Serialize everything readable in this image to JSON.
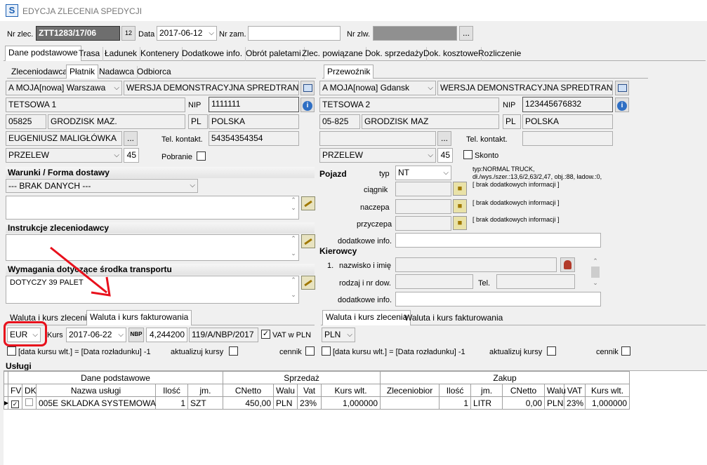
{
  "window": {
    "title": "EDYCJA ZLECENIA SPEDYCJI",
    "app_icon": "S"
  },
  "header": {
    "nr_zlec_label": "Nr zlec.",
    "nr_zlec_value": "ZTT1283/17/06",
    "data_label": "Data",
    "data_value": "2017-06-12",
    "nr_zam_label": "Nr zam.",
    "nr_zam_value": "",
    "nr_zlw_label": "Nr zlw.",
    "nr_zlw_value": "",
    "ellipsis": "..."
  },
  "main_tabs": [
    "Dane podstawowe",
    "Trasa",
    "Ładunek",
    "Kontenery",
    "Dodatkowe info.",
    "Obrót paletami",
    "Zlec. powiązane",
    "Dok. sprzedaży",
    "Dok. kosztowe",
    "Rozliczenie"
  ],
  "left": {
    "tabs": [
      "Zleceniodawca",
      "Płatnik",
      "Nadawca",
      "Odbiorca"
    ],
    "short_name": "A MOJA[nowa] Warszawa",
    "full_name": "WERSJA DEMONSTRACYJNA SPREDTRANS SQL",
    "street": "TETSOWA 1",
    "nip_label": "NIP",
    "nip_value": "1111111",
    "postal": "05825",
    "city": "GRODZISK MAZ.",
    "country_code": "PL",
    "country": "POLSKA",
    "contact": "EUGENIUSZ  MALIGŁÓWKA",
    "tel_label": "Tel. kontakt.",
    "tel_value": "54354354354",
    "payment": "PRZELEW",
    "days": "45",
    "pobranie_label": "Pobranie"
  },
  "right": {
    "tabs": [
      "Przewoźnik"
    ],
    "short_name": "A MOJA[nowa] Gdansk",
    "full_name": "WERSJA DEMONSTRACYJNA SPREDTRANS SQL WE",
    "street": "TETSOWA 2",
    "nip_label": "NIP",
    "nip_value": "123445676832",
    "postal": "05-825",
    "city": "GRODZISK MAZ",
    "country_code": "PL",
    "country": "POLSKA",
    "contact": "",
    "tel_label": "Tel. kontakt.",
    "tel_value": "",
    "payment": "PRZELEW",
    "days": "45",
    "skonto_label": "Skonto"
  },
  "warunki": {
    "title": "Warunki / Forma dostawy",
    "select_value": "--- BRAK DANYCH ---",
    "memo": ""
  },
  "instrukcje": {
    "title": "Instrukcje zleceniodawcy",
    "memo": ""
  },
  "wymagania": {
    "title": "Wymagania dotyczące środka transportu",
    "memo": "DOTYCZY 39 PALET"
  },
  "pojazd": {
    "title": "Pojazd",
    "typ_label": "typ",
    "typ_value": "NT",
    "typ_info1": "typ:NORMAL TRUCK,",
    "typ_info2": "dł./wys./szer.:13,6/2,63/2,47, obj.:88, ładow.:0,",
    "typ_info3": "[ brak dodatkowych informacji ]",
    "ciagnik_label": "ciągnik",
    "naczepa_label": "naczepa",
    "naczepa_info": "[ brak dodatkowych informacji ]",
    "przyczepa_label": "przyczepa",
    "przyczepa_info": "[ brak dodatkowych informacji ]",
    "dodatkowe_label": "dodatkowe info."
  },
  "kierowcy": {
    "title": "Kierowcy",
    "nr": "1.",
    "name_label": "nazwisko i imię",
    "doc_label": "rodzaj i nr dow.",
    "tel_label": "Tel.",
    "dodatkowe_label": "dodatkowe info."
  },
  "waluta_left": {
    "tabs": [
      "Waluta i kurs zlecenia",
      "Waluta i kurs fakturowania"
    ],
    "currency": "EUR",
    "kurs_label": "Kurs",
    "kurs_date": "2017-06-22",
    "nbp": "NBP",
    "rate": "4,244200",
    "table_no": "119/A/NBP/2017",
    "vat_label": "VAT w PLN",
    "data_kursu_label": "[data kursu wlt.] = [Data rozładunku] -1",
    "aktualizuj_label": "aktualizuj kursy",
    "cennik_label": "cennik"
  },
  "waluta_right": {
    "tabs": [
      "Waluta i kurs zlecenia",
      "Waluta i kurs fakturowania"
    ],
    "currency": "PLN",
    "data_kursu_label": "[data kursu wlt.] = [Data rozładunku] -1",
    "aktualizuj_label": "aktualizuj kursy",
    "cennik_label": "cennik"
  },
  "uslugi": {
    "title": "Usługi",
    "group_headers": [
      "Dane podstawowe",
      "Sprzedaż",
      "Zakup"
    ],
    "columns": [
      "FV",
      "DK",
      "Nazwa usługi",
      "Ilość",
      "jm.",
      "CNetto",
      "Walu",
      "Vat",
      "Kurs wlt.",
      "Zleceniobior",
      "Ilość",
      "jm.",
      "CNetto",
      "Walu",
      "VAT",
      "Kurs wlt."
    ],
    "rows": [
      [
        "",
        "",
        "005E SKLADKA SYSTEMOWA",
        "1",
        "SZT",
        "450,00",
        "PLN",
        "23%",
        "1,000000",
        "",
        "1",
        "LITR",
        "0,00",
        "PLN",
        "23%",
        "1,000000"
      ]
    ]
  },
  "colors": {
    "highlight": "#e8101c",
    "arrow": "#e8101c"
  }
}
